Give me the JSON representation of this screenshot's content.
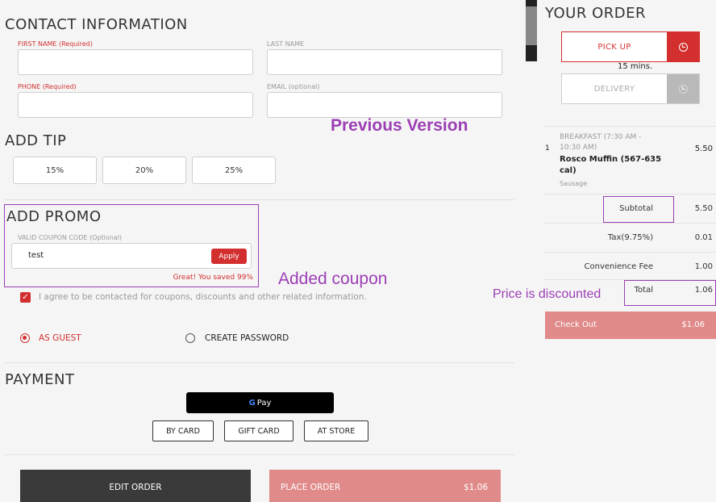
{
  "contact": {
    "title": "CONTACT INFORMATION",
    "first_name_label": "FIRST NAME (Required)",
    "last_name_label": "LAST NAME",
    "phone_label": "PHONE (Required)",
    "email_label": "EMAIL (optional)"
  },
  "tip": {
    "title": "ADD TIP",
    "options": [
      "15%",
      "20%",
      "25%"
    ]
  },
  "promo": {
    "title": "ADD PROMO",
    "field_label": "VALID COUPON CODE (Optional)",
    "value": "test",
    "apply_label": "Apply",
    "success_msg": "Great! You saved 99%"
  },
  "consent": {
    "text": "I agree to be contacted for coupons, discounts and other related information."
  },
  "account": {
    "guest_label": "AS GUEST",
    "create_label": "CREATE PASSWORD",
    "selected": "guest"
  },
  "payment": {
    "title": "PAYMENT",
    "gpay_letter": "G",
    "gpay_label": "Pay",
    "methods": [
      "BY CARD",
      "GIFT CARD",
      "AT STORE"
    ]
  },
  "actions": {
    "edit_label": "EDIT ORDER",
    "place_label": "PLACE ORDER",
    "place_amount": "$1.06"
  },
  "annotations": {
    "previous_version": "Previous Version",
    "added_coupon": "Added coupon",
    "price_discounted": "Price is discounted"
  },
  "order": {
    "title": "YOUR ORDER",
    "pickup_label": "PICK UP",
    "pickup_time": "15 mins.",
    "delivery_label": "DELIVERY",
    "item": {
      "qty": "1",
      "category": "BREAKFAST (7:30 AM - 10:30 AM)",
      "name": "Rosco Muffin (567-635 cal)",
      "option": "Sausage",
      "price": "5.50"
    },
    "summary": {
      "subtotal_label": "Subtotal",
      "subtotal": "5.50",
      "tax_label": "Tax(9.75%)",
      "tax": "0.01",
      "fee_label": "Convenience Fee",
      "fee": "1.00",
      "total_label": "Total",
      "total": "1.06"
    },
    "checkout_label": "Check Out",
    "checkout_amount": "$1.06"
  },
  "colors": {
    "accent": "#d32f2f",
    "annotation": "#9c3fb5",
    "disabled_pink": "#e08a8a",
    "dark_button": "#3a3a3a"
  }
}
